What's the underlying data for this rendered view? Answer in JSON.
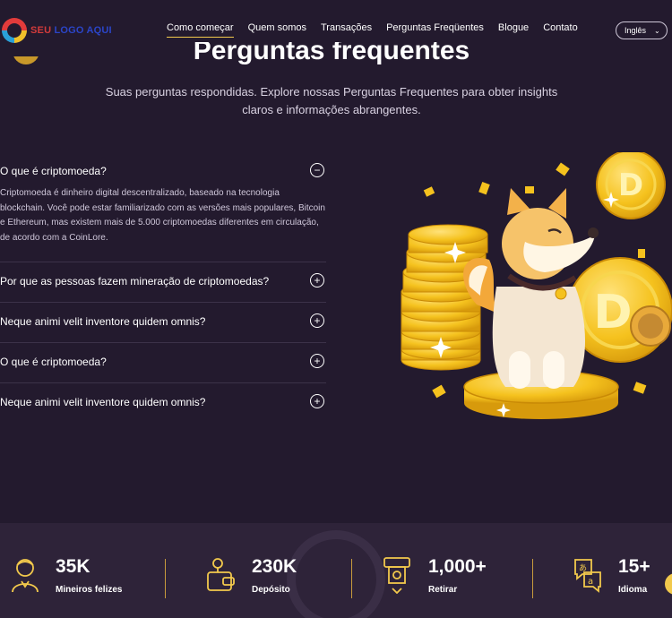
{
  "nav": {
    "logo_prefix": "SEU",
    "logo_rest": " LOGO AQUI",
    "items": [
      {
        "label": "Como começar",
        "active": true
      },
      {
        "label": "Quem somos"
      },
      {
        "label": "Transações"
      },
      {
        "label": "Perguntas Freqüentes"
      },
      {
        "label": "Blogue"
      },
      {
        "label": "Contato"
      }
    ],
    "language": "Inglês"
  },
  "faq": {
    "title": "Perguntas frequentes",
    "subtitle": "Suas perguntas respondidas. Explore nossas Perguntas Frequentes para obter insights claros e informações abrangentes.",
    "items": [
      {
        "question": "O que é criptomoeda?",
        "expanded": true,
        "answer": "Criptomoeda é dinheiro digital descentralizado, baseado na tecnologia blockchain. Você pode estar familiarizado com as versões mais populares, Bitcoin e Ethereum, mas existem mais de 5.000 criptomoedas diferentes em circulação, de acordo com a CoinLore."
      },
      {
        "question": "Por que as pessoas fazem mineração de criptomoedas?",
        "expanded": false
      },
      {
        "question": "Neque animi velit inventore quidem omnis?",
        "expanded": false
      },
      {
        "question": "O que é criptomoeda?",
        "expanded": false
      },
      {
        "question": "Neque animi velit inventore quidem omnis?",
        "expanded": false
      }
    ]
  },
  "stats": [
    {
      "value": "35K",
      "label": "Mineiros felizes",
      "icon": "person-icon"
    },
    {
      "value": "230K",
      "label": "Depósito",
      "icon": "wallet-icon"
    },
    {
      "value": "1,000+",
      "label": "Retirar",
      "icon": "atm-withdraw-icon"
    },
    {
      "value": "15+",
      "label": "Idioma",
      "icon": "language-icon"
    }
  ],
  "colors": {
    "background": "#231a2e",
    "accent": "#f2c94c",
    "stats_bg": "#2e2339"
  }
}
